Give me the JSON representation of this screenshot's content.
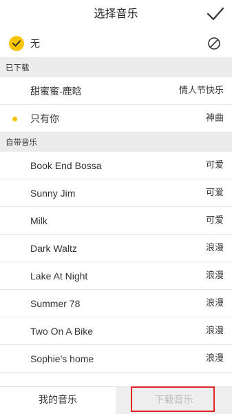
{
  "header": {
    "title": "选择音乐"
  },
  "none_option": {
    "label": "无"
  },
  "sections": {
    "downloaded": "已下载",
    "builtin": "自带音乐"
  },
  "downloaded": [
    {
      "name": "甜蜜蜜-鹿晗",
      "tag": "情人节快乐"
    },
    {
      "name": "只有你",
      "tag": "神曲",
      "playing": true
    }
  ],
  "builtin": [
    {
      "name": "Book End Bossa",
      "tag": "可爱"
    },
    {
      "name": "Sunny Jim",
      "tag": "可爱"
    },
    {
      "name": "Milk",
      "tag": "可爱"
    },
    {
      "name": "Dark Waltz",
      "tag": "浪漫"
    },
    {
      "name": "Lake At Night",
      "tag": "浪漫"
    },
    {
      "name": "Summer 78",
      "tag": "浪漫"
    },
    {
      "name": "Two On A Bike",
      "tag": "浪漫"
    },
    {
      "name": "Sophie's home",
      "tag": "浪漫"
    }
  ],
  "tabs": {
    "mine": "我的音乐",
    "download": "下载音乐"
  },
  "colors": {
    "accent": "#f7c400",
    "highlight": "#e02424"
  }
}
